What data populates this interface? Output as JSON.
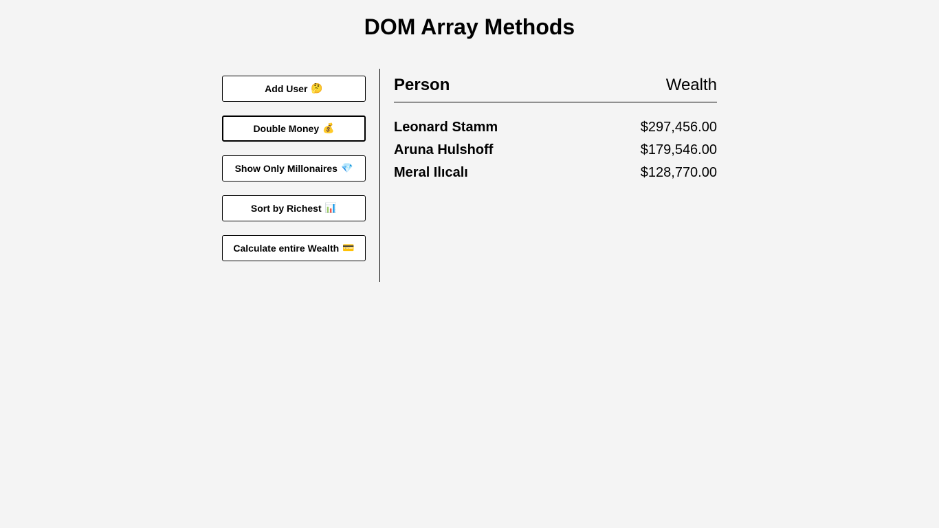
{
  "page": {
    "title": "DOM Array Methods"
  },
  "sidebar": {
    "buttons": [
      {
        "label": "Add User",
        "emoji": "🤔"
      },
      {
        "label": "Double Money",
        "emoji": "💰"
      },
      {
        "label": "Show Only Millonaires",
        "emoji": "💎"
      },
      {
        "label": "Sort by Richest",
        "emoji": "📊"
      },
      {
        "label": "Calculate entire Wealth",
        "emoji": "💳"
      }
    ]
  },
  "main": {
    "header": {
      "person": "Person",
      "wealth": "Wealth"
    },
    "people": [
      {
        "name": "Leonard Stamm",
        "wealth": "$297,456.00"
      },
      {
        "name": "Aruna Hulshoff",
        "wealth": "$179,546.00"
      },
      {
        "name": "Meral Ilıcalı",
        "wealth": "$128,770.00"
      }
    ]
  }
}
